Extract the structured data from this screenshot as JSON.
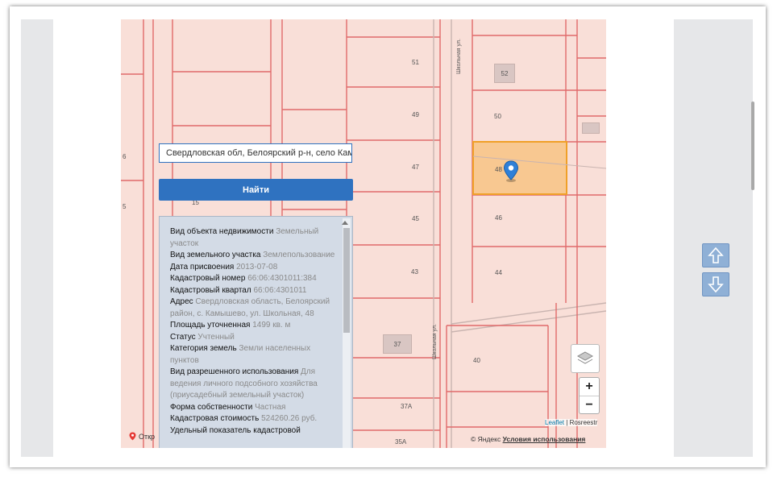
{
  "search": {
    "value": "Свердловская обл, Белоярский р-н, село Кам"
  },
  "find_button": {
    "label": "Найти"
  },
  "info_rows": [
    {
      "key": "Вид объекта недвижимости",
      "value": "Земельный участок"
    },
    {
      "key": "Вид земельного участка",
      "value": "Землепользование"
    },
    {
      "key": "Дата присвоения",
      "value": "2013-07-08"
    },
    {
      "key": "Кадастровый номер",
      "value": "66:06:4301011:384"
    },
    {
      "key": "Кадастровый квартал",
      "value": "66:06:4301011"
    },
    {
      "key": "Адрес",
      "value": "Свердловская область, Белоярский район, с. Камышево, ул. Школьная, 48"
    },
    {
      "key": "Площадь уточненная",
      "value": "1499 кв. м"
    },
    {
      "key": "Статус",
      "value": "Учтенный"
    },
    {
      "key": "Категория земель",
      "value": "Земли населенных пунктов"
    },
    {
      "key": "Вид разрешенного использования",
      "value": "Для ведения личного подсобного хозяйства (приусадебный земельный участок)"
    },
    {
      "key": "Форма собственности",
      "value": "Частная"
    },
    {
      "key": "Кадастровая стоимость",
      "value": "524260.26 руб."
    },
    {
      "key": "Удельный показатель кадастровой",
      "value": ""
    }
  ],
  "lots": [
    "51",
    "49",
    "47",
    "45",
    "43",
    "52",
    "50",
    "48",
    "46",
    "44",
    "37",
    "40",
    "37А",
    "35А",
    "6",
    "5",
    "15"
  ],
  "streets": [
    "Школьная ул.",
    "Школьная ул."
  ],
  "map_controls": {
    "zoom_in": "+",
    "zoom_out": "−"
  },
  "attribution": {
    "leaflet": "Leaflet",
    "separator": " | ",
    "rosreestr": "Rosreestr"
  },
  "yandex": {
    "copyright": "© Яндекс",
    "terms": "Условия использования"
  },
  "open_link": "Откр",
  "colors": {
    "accent": "#2f72c0",
    "parcel_fill": "#f8c891",
    "parcel_border": "#f0a028",
    "map_bg": "#f9dfd8",
    "lot_line": "#e06a6a"
  }
}
